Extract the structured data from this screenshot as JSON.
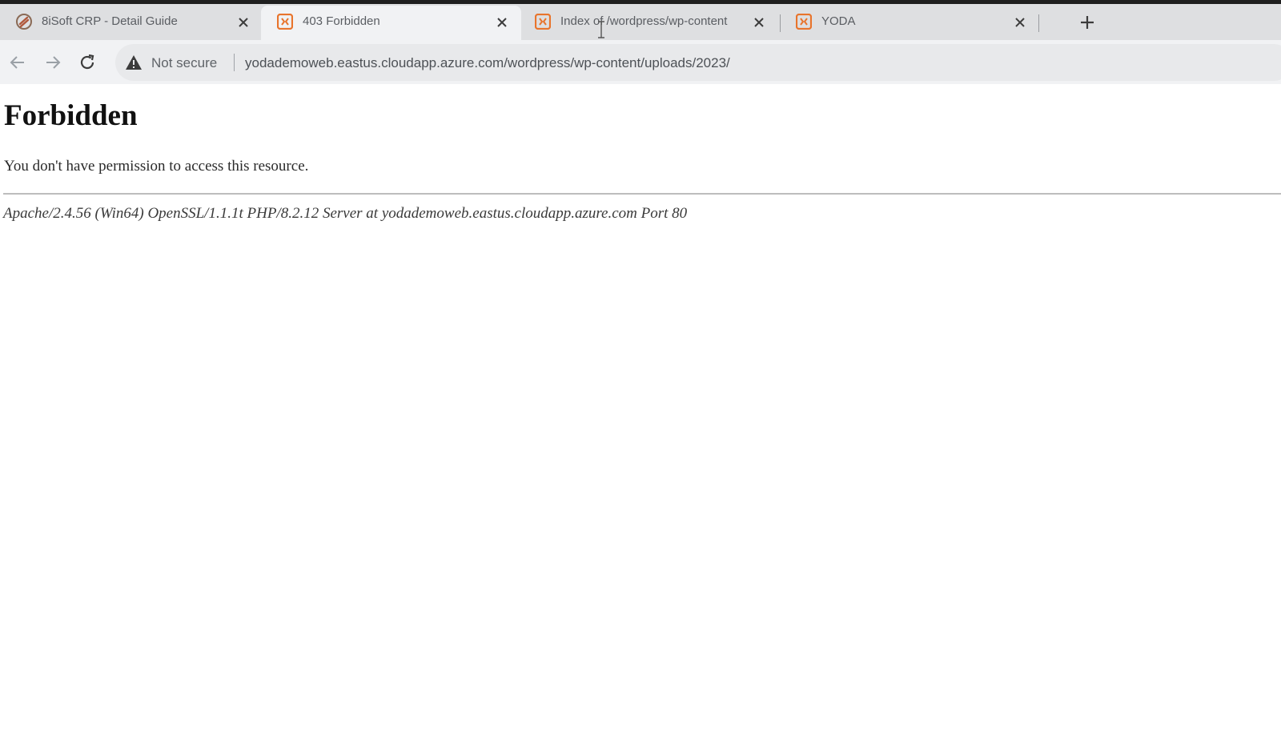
{
  "browser": {
    "tabs": [
      {
        "title": "8iSoft CRP - Detail Guide",
        "favicon": "8isoft-logo-icon",
        "active": false
      },
      {
        "title": "403 Forbidden",
        "favicon": "xampp-icon",
        "active": true
      },
      {
        "title": "Index of /wordpress/wp-content",
        "favicon": "xampp-icon",
        "active": false
      },
      {
        "title": "YODA",
        "favicon": "xampp-icon",
        "active": false
      }
    ],
    "security_label": "Not secure",
    "url": "yodademoweb.eastus.cloudapp.azure.com/wordpress/wp-content/uploads/2023/"
  },
  "page": {
    "heading": "Forbidden",
    "message": "You don't have permission to access this resource.",
    "server_signature": "Apache/2.4.56 (Win64) OpenSSL/1.1.1t PHP/8.2.12 Server at yodademoweb.eastus.cloudapp.azure.com Port 80"
  },
  "colors": {
    "favicon_accent": "#e8742c",
    "tabstrip_bg": "#dedfe1",
    "toolbar_bg": "#f1f2f4"
  }
}
